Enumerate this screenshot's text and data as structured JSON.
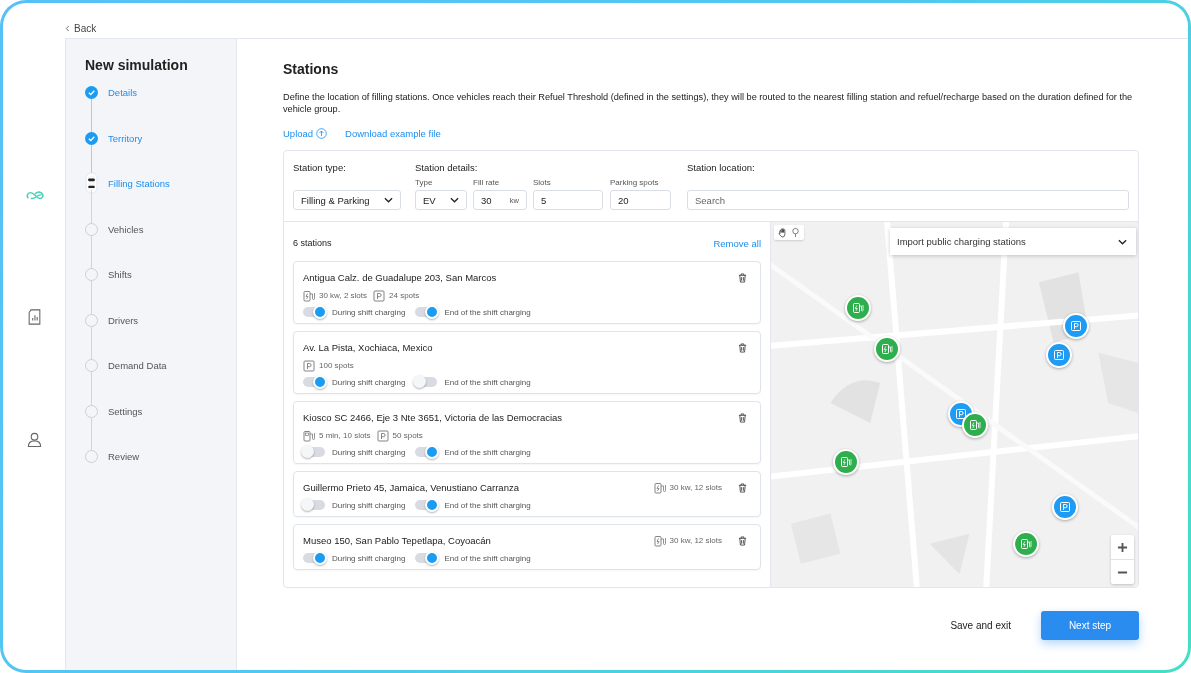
{
  "back": "Back",
  "sidebar": {
    "title": "New simulation",
    "steps": [
      {
        "label": "Details",
        "completed": true,
        "selected": false
      },
      {
        "label": "Territory",
        "completed": true,
        "selected": false
      },
      {
        "label": "Filling Stations",
        "completed": false,
        "selected": true
      },
      {
        "label": "Vehicles",
        "completed": false,
        "selected": false
      },
      {
        "label": "Shifts",
        "completed": false,
        "selected": false
      },
      {
        "label": "Drivers",
        "completed": false,
        "selected": false
      },
      {
        "label": "Demand Data",
        "completed": false,
        "selected": false
      },
      {
        "label": "Settings",
        "completed": false,
        "selected": false
      },
      {
        "label": "Review",
        "completed": false,
        "selected": false
      }
    ]
  },
  "page": {
    "title": "Stations",
    "description": "Define the location of filling stations. Once vehicles reach their Refuel Threshold (defined in the settings), they will be routed to the nearest filling station and refuel/recharge based on the duration defined for the vehicle group.",
    "upload": "Upload",
    "download": "Download example file"
  },
  "filters": {
    "station_type": {
      "label": "Station type:",
      "value": "Filling & Parking"
    },
    "details_label": "Station details:",
    "type": {
      "label": "Type",
      "value": "EV"
    },
    "fill_rate": {
      "label": "Fill rate",
      "value": "30",
      "unit": "kw"
    },
    "slots": {
      "label": "Slots",
      "value": "5"
    },
    "parking": {
      "label": "Parking spots",
      "value": "20"
    },
    "location": {
      "label": "Station location:",
      "placeholder": "Search"
    }
  },
  "list": {
    "count": "6 stations",
    "remove_all": "Remove all"
  },
  "stations": [
    {
      "name": "Antigua Calz. de Guadalupe 203, San Marcos",
      "meta": [
        {
          "kind": "charger",
          "text": "30 kw, 2 slots"
        },
        {
          "kind": "parking",
          "text": "24 spots"
        }
      ],
      "toggles": [
        {
          "label": "During shift charging",
          "on": true
        },
        {
          "label": "End of the shift charging",
          "on": true
        }
      ]
    },
    {
      "name": "Av. La Pista, Xochiaca, Mexico",
      "meta": [
        {
          "kind": "parking",
          "text": "100 spots"
        }
      ],
      "toggles": [
        {
          "label": "During shift charging",
          "on": true
        },
        {
          "label": "End of the shift charging",
          "on": false
        }
      ]
    },
    {
      "name": "Kiosco SC 2466, Eje 3 Nte 3651, Victoria de las Democracias",
      "meta": [
        {
          "kind": "pump",
          "text": "5 min, 10 slots"
        },
        {
          "kind": "parking",
          "text": "50 spots"
        }
      ],
      "toggles": [
        {
          "label": "During shift charging",
          "on": false
        },
        {
          "label": "End of the shift charging",
          "on": true
        }
      ]
    },
    {
      "name": "Guillermo Prieto 45, Jamaica, Venustiano Carranza",
      "side_meta": [
        {
          "kind": "charger",
          "text": "30 kw, 12 slots"
        }
      ],
      "toggles": [
        {
          "label": "During shift charging",
          "on": false
        },
        {
          "label": "End of the shift charging",
          "on": true
        }
      ]
    },
    {
      "name": "Museo 150, San Pablo Tepetlapa, Coyoacán",
      "side_meta": [
        {
          "kind": "charger",
          "text": "30 kw, 12 slots"
        }
      ],
      "toggles": [
        {
          "label": "During shift charging",
          "on": true
        },
        {
          "label": "End of the shift charging",
          "on": true
        }
      ]
    }
  ],
  "map": {
    "import": "Import public charging stations",
    "pins": [
      {
        "kind": "charger"
      },
      {
        "kind": "charger"
      },
      {
        "kind": "parking"
      },
      {
        "kind": "parking"
      },
      {
        "kind": "parking"
      },
      {
        "kind": "charger"
      },
      {
        "kind": "charger"
      },
      {
        "kind": "parking"
      },
      {
        "kind": "charger"
      }
    ]
  },
  "actions": {
    "secondary": "Save and exit",
    "primary": "Next step"
  }
}
